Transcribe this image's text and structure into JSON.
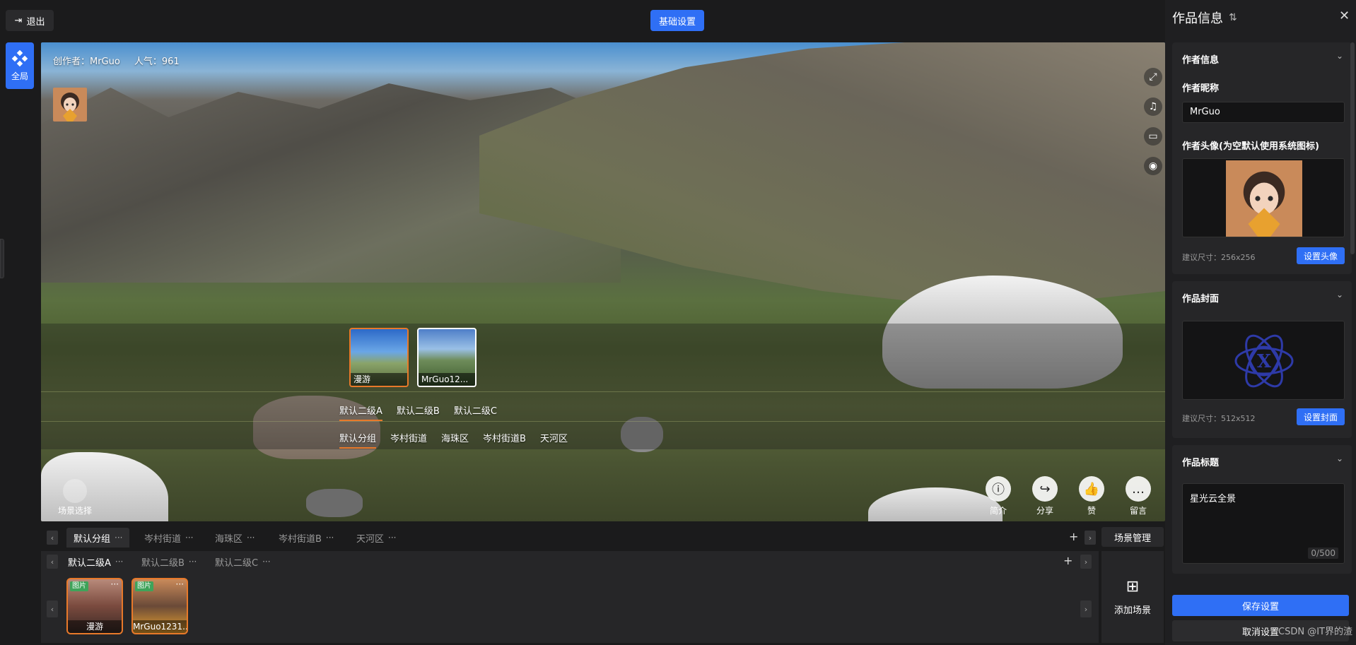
{
  "topbar": {
    "exit_label": "退出",
    "basic_settings_label": "基础设置"
  },
  "left_rail": {
    "global_label": "全局"
  },
  "viewer": {
    "creator_label": "创作者：MrGuo",
    "popularity_label": "人气：961",
    "scene_thumbs": [
      {
        "label": "漫游"
      },
      {
        "label": "MrGuo12..."
      }
    ],
    "level2_tabs": [
      "默认二级A",
      "默认二级B",
      "默认二级C"
    ],
    "group_tabs": [
      "默认分组",
      "岑村街道",
      "海珠区",
      "岑村街道B",
      "天河区"
    ],
    "scene_select_label": "场景选择",
    "actions": [
      {
        "label": "简介",
        "icon": "info-icon"
      },
      {
        "label": "分享",
        "icon": "share-icon"
      },
      {
        "label": "赞",
        "icon": "like-icon"
      },
      {
        "label": "留言",
        "icon": "comment-icon"
      }
    ]
  },
  "bottom": {
    "group_tabs": [
      "默认分组",
      "岑村街道",
      "海珠区",
      "岑村街道B",
      "天河区"
    ],
    "level2_tabs": [
      "默认二级A",
      "默认二级B",
      "默认二级C"
    ],
    "tray_items": [
      {
        "badge": "图片",
        "label": "漫游"
      },
      {
        "badge": "图片",
        "label": "MrGuo1231..."
      }
    ],
    "scene_mgmt_label": "场景管理",
    "add_scene_label": "添加场景",
    "more_glyph": "···",
    "plus_glyph": "+"
  },
  "panel": {
    "title": "作品信息",
    "author_section": {
      "title": "作者信息",
      "nickname_label": "作者昵称",
      "nickname_value": "MrGuo",
      "avatar_label": "作者头像(为空默认使用系统图标)",
      "avatar_hint": "建议尺寸：256x256",
      "avatar_button": "设置头像"
    },
    "cover_section": {
      "title": "作品封面",
      "cover_hint": "建议尺寸：512x512",
      "cover_button": "设置封面"
    },
    "title_section": {
      "title": "作品标题",
      "value": "星光云全景",
      "counter": "0/500"
    },
    "save_button": "保存设置",
    "cancel_button": "取消设置"
  },
  "watermark": "CSDN @IT界的渣",
  "colors": {
    "accent": "#2f6ff5",
    "highlight": "#e8792a",
    "badge": "#3fa35a"
  }
}
